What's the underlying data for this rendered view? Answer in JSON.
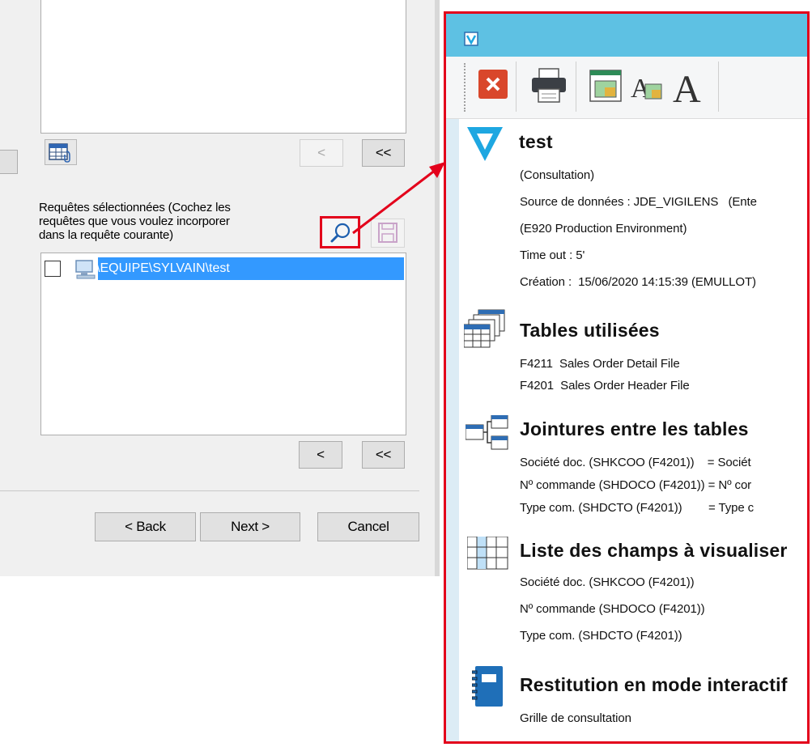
{
  "left_dialog": {
    "available_list_buttons": {
      "remove_one": "<",
      "remove_all": "<<"
    },
    "selected_label": "Requêtes sélectionnées (Cochez les requêtes que vous voulez incorporer dans la requête courante)",
    "selected_label_lines": [
      "Requêtes sélectionnées (Cochez les",
      "requêtes que vous voulez incorporer",
      "dans la requête courante)"
    ],
    "selected_items": [
      {
        "path": "\\EQUIPE\\SYLVAIN\\test",
        "checked": false
      }
    ],
    "selected_list_buttons": {
      "remove_one": "<",
      "remove_all": "<<"
    },
    "nav": {
      "back": "< Back",
      "next": "Next >",
      "cancel": "Cancel"
    }
  },
  "report": {
    "title": "test",
    "info_lines": [
      "(Consultation)",
      "Source de données : JDE_VIGILENS   (Ente",
      "(E920 Production Environment)",
      "Time out : 5'",
      "Création :  15/06/2020 14:15:39 (EMULLOT)"
    ],
    "sections": {
      "tables": {
        "title": "Tables utilisées",
        "lines": [
          "F4211  Sales Order Detail File",
          "F4201  Sales Order Header File"
        ]
      },
      "joins": {
        "title": "Jointures entre les tables",
        "lines": [
          "Société doc. (SHKCOO (F4201))    = Sociét",
          "Nº commande (SHDOCO (F4201)) = Nº cor",
          "Type com. (SHDCTO (F4201))        = Type c"
        ]
      },
      "fields": {
        "title": "Liste des champs à visualiser",
        "lines": [
          "Société doc. (SHKCOO (F4201))",
          "Nº commande (SHDOCO (F4201))",
          "Type com. (SHDCTO (F4201))"
        ]
      },
      "restitution": {
        "title": "Restitution en mode interactif",
        "lines": [
          "Grille de consultation"
        ]
      }
    }
  },
  "colors": {
    "highlight": "#e3001b",
    "titlebar": "#5ec1e3",
    "selection": "#3399ff",
    "logo": "#1ea7e1"
  }
}
